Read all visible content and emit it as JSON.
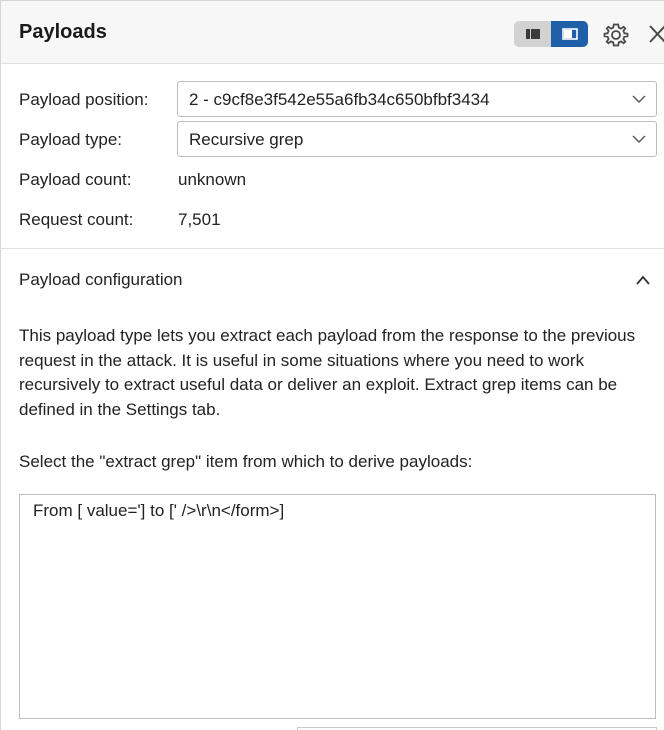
{
  "header": {
    "title": "Payloads",
    "icons": {
      "layout_left": "panel-layout-compact-icon",
      "layout_right": "panel-layout-split-icon",
      "settings": "gear-icon",
      "close": "close-icon"
    },
    "accent_color": "#1f5fa8"
  },
  "fields": {
    "payload_position": {
      "label": "Payload position:",
      "selected": "2 - c9cf8e3f542e55a6fb34c650bfbf3434"
    },
    "payload_type": {
      "label": "Payload type:",
      "selected": "Recursive grep"
    },
    "payload_count": {
      "label": "Payload count:",
      "value": "unknown"
    },
    "request_count": {
      "label": "Request count:",
      "value": "7,501"
    }
  },
  "config": {
    "title": "Payload configuration",
    "description": "This payload type lets you extract each payload from the response to the previous request in the attack. It is useful in some situations where you need to work recursively to extract useful data or deliver an exploit. Extract grep items can be defined in the Settings tab.",
    "select_label": "Select the \"extract grep\" item from which to derive payloads:",
    "items": [
      "From [ value='] to [' />\\r\\n</form>]"
    ]
  }
}
